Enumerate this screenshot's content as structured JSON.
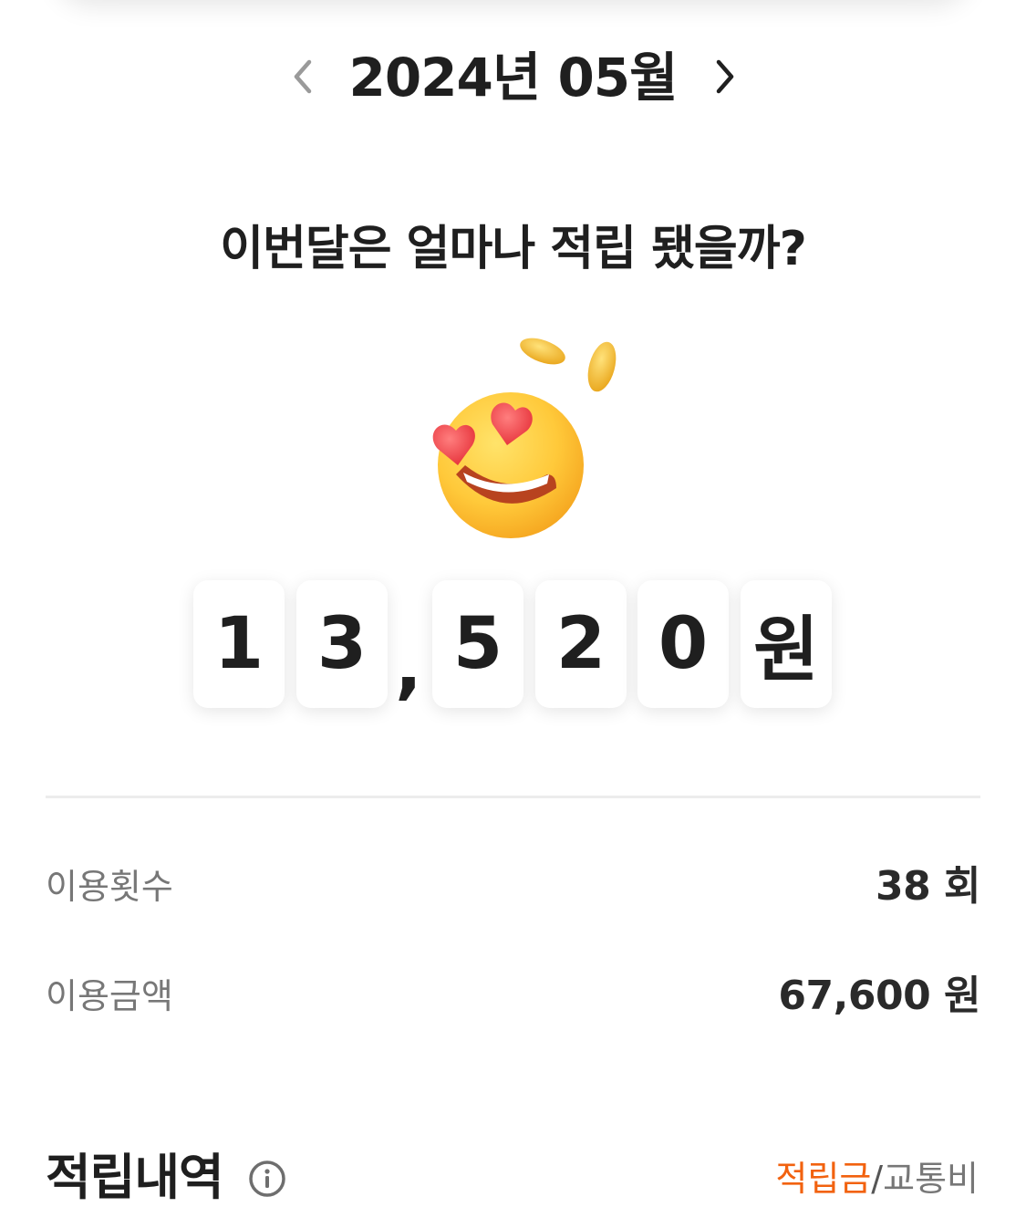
{
  "month_nav": {
    "title": "2024년 05월",
    "prev_icon": "chevron-left-icon",
    "next_icon": "chevron-right-icon"
  },
  "summary": {
    "headline": "이번달은 얼마나 적립 됐을까?",
    "emoji": "heart-eyes-smiley-with-coins",
    "amount_digits": [
      "1",
      "3",
      ",",
      "5",
      "2",
      "0",
      "원"
    ]
  },
  "stats": [
    {
      "label": "이용횟수",
      "value": "38 회"
    },
    {
      "label": "이용금액",
      "value": "67,600 원"
    }
  ],
  "history": {
    "title": "적립내역",
    "info_icon": "info-icon",
    "toggle_active": "적립금",
    "toggle_separator": "/",
    "toggle_inactive": "교통비"
  },
  "colors": {
    "accent": "#f2620f",
    "text_primary": "#1f1f1f",
    "text_secondary": "#777777",
    "divider": "#ececec"
  }
}
